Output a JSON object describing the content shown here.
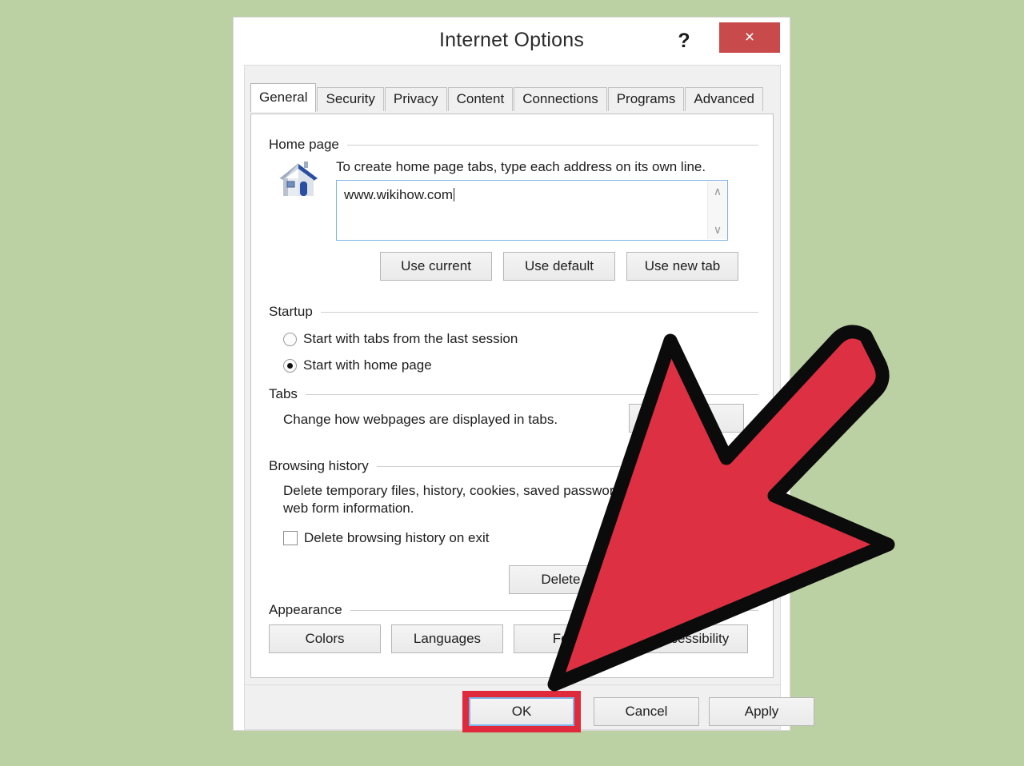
{
  "window": {
    "title": "Internet Options",
    "help_label": "?",
    "close_label": "×"
  },
  "tabs": {
    "items": [
      {
        "label": "General",
        "active": true
      },
      {
        "label": "Security",
        "active": false
      },
      {
        "label": "Privacy",
        "active": false
      },
      {
        "label": "Content",
        "active": false
      },
      {
        "label": "Connections",
        "active": false
      },
      {
        "label": "Programs",
        "active": false
      },
      {
        "label": "Advanced",
        "active": false
      }
    ]
  },
  "home_page": {
    "group_label": "Home page",
    "description": "To create home page tabs, type each address on its own line.",
    "value": "www.wikihow.com",
    "scroll_up": "∧",
    "scroll_down": "∨",
    "buttons": {
      "use_current": "Use current",
      "use_default": "Use default",
      "use_new_tab": "Use new tab"
    }
  },
  "startup": {
    "group_label": "Startup",
    "options": [
      {
        "label": "Start with tabs from the last session",
        "selected": false
      },
      {
        "label": "Start with home page",
        "selected": true
      }
    ]
  },
  "tabs_group": {
    "group_label": "Tabs",
    "description": "Change how webpages are displayed in tabs.",
    "settings_button": ""
  },
  "browsing_history": {
    "group_label": "Browsing history",
    "description": "Delete temporary files, history, cookies, saved passwords, and web form information.",
    "checkbox_label": "Delete browsing history on exit",
    "checkbox_checked": false,
    "delete_button": "Delete..."
  },
  "appearance": {
    "group_label": "Appearance",
    "buttons": {
      "colors": "Colors",
      "languages": "Languages",
      "fonts": "Fonts",
      "accessibility": "Accessibility"
    }
  },
  "footer": {
    "ok": "OK",
    "cancel": "Cancel",
    "apply": "Apply"
  },
  "colors": {
    "background": "#bbd0a3",
    "arrow_red": "#dd3042",
    "close_red": "#c94a4a",
    "highlight_red": "#e02a3c",
    "focus_blue": "#7eb4ea"
  }
}
